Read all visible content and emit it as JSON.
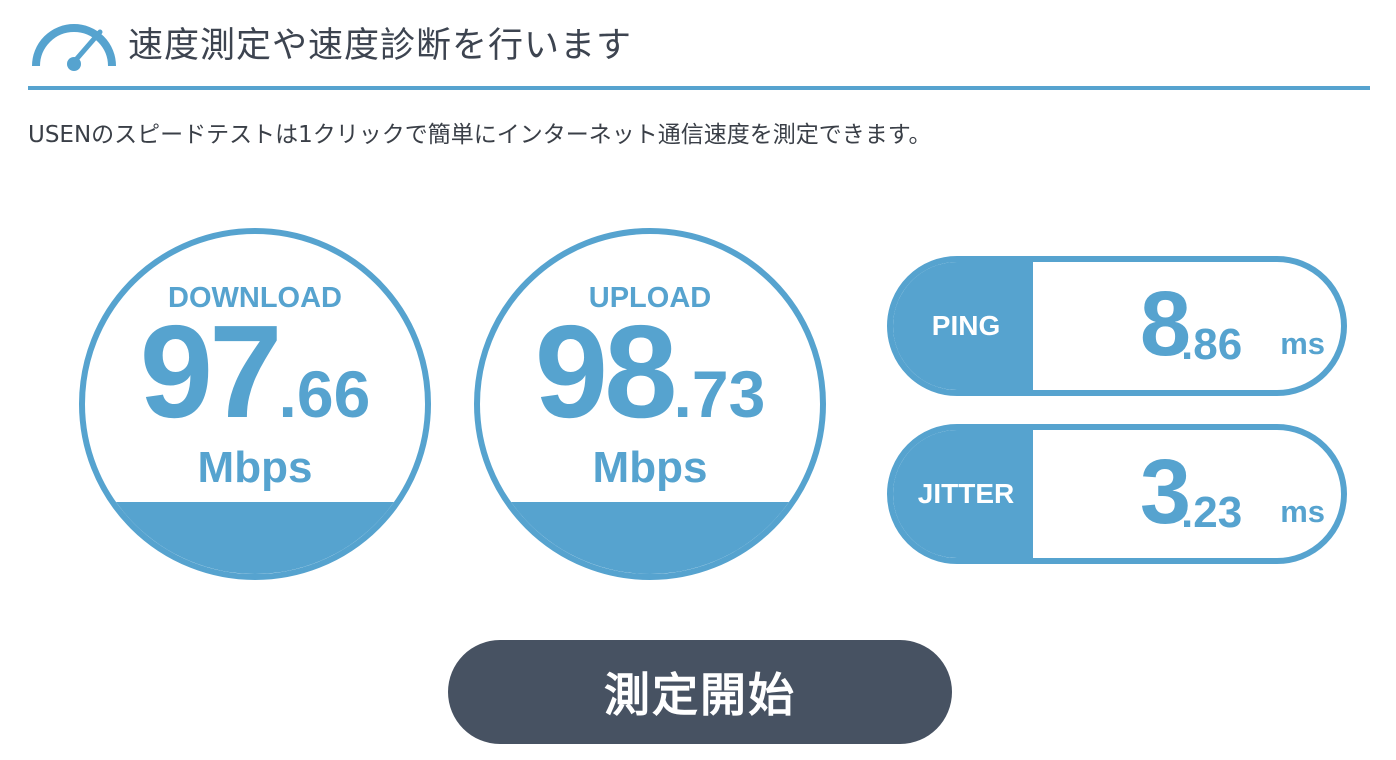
{
  "header": {
    "title": "速度測定や速度診断を行います",
    "icon": "speedometer-icon",
    "accent_color": "#56a3cf"
  },
  "intro": {
    "text": "USENのスピードテストは1クリックで簡単にインターネット通信速度を測定できます。"
  },
  "download": {
    "label": "DOWNLOAD",
    "value_int": "97",
    "value_dec": ".66",
    "unit": "Mbps"
  },
  "upload": {
    "label": "UPLOAD",
    "value_int": "98",
    "value_dec": ".73",
    "unit": "Mbps"
  },
  "ping": {
    "label": "PING",
    "value_int": "8",
    "value_dec": ".86",
    "unit": "ms"
  },
  "jitter": {
    "label": "JITTER",
    "value_int": "3",
    "value_dec": ".23",
    "unit": "ms"
  },
  "start_button": {
    "label": "測定開始",
    "color": "#475262"
  }
}
